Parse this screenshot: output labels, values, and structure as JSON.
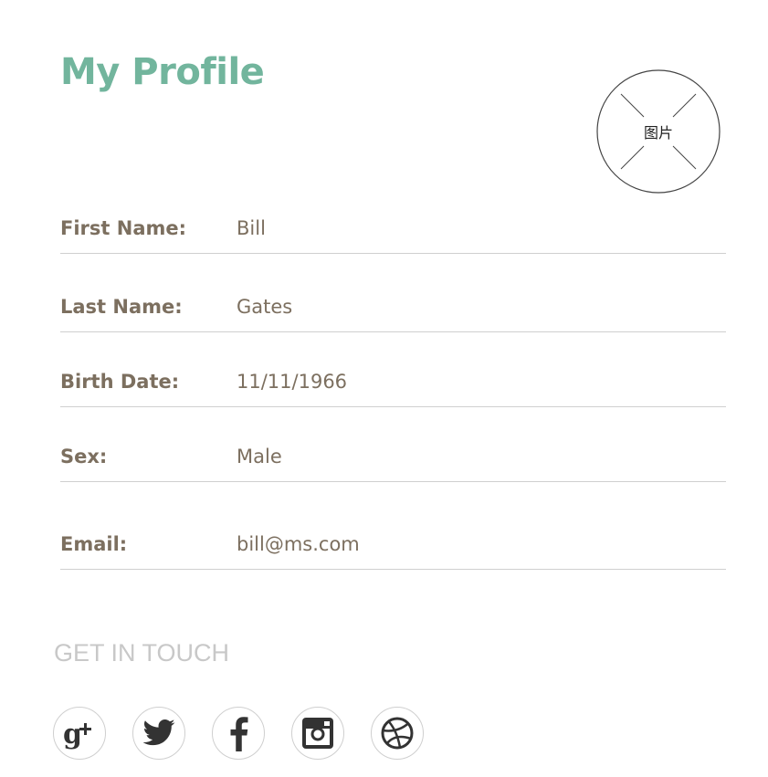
{
  "header": {
    "title": "My Profile"
  },
  "avatar": {
    "placeholder_label": "图片"
  },
  "profile": {
    "fields": [
      {
        "label": "First Name:",
        "value": "Bill"
      },
      {
        "label": "Last Name:",
        "value": "Gates"
      },
      {
        "label": "Birth Date:",
        "value": "11/11/1966"
      },
      {
        "label": "Sex:",
        "value": "Male"
      },
      {
        "label": "Email:",
        "value": "bill@ms.com"
      }
    ]
  },
  "contact": {
    "heading": "GET IN TOUCH",
    "socials": [
      {
        "icon": "google-plus-icon"
      },
      {
        "icon": "twitter-icon"
      },
      {
        "icon": "facebook-icon"
      },
      {
        "icon": "instagram-icon"
      },
      {
        "icon": "dribbble-icon"
      }
    ]
  },
  "colors": {
    "accent": "#72b59d",
    "text": "#7c6f5f",
    "muted": "#c8c8c8",
    "divider": "#cfcfcf",
    "icon": "#333333"
  }
}
